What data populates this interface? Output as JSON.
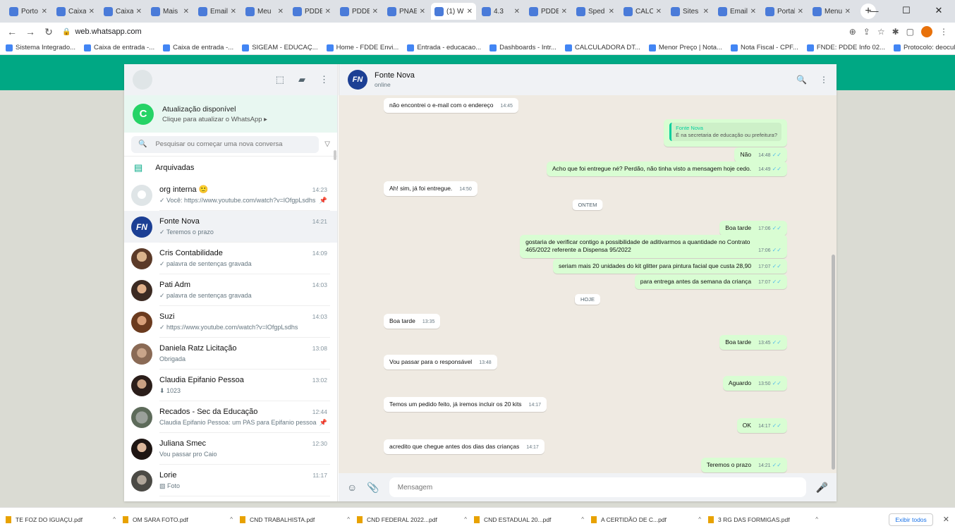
{
  "browser": {
    "tabs": [
      {
        "label": "Porto"
      },
      {
        "label": "Caixa"
      },
      {
        "label": "Caixa"
      },
      {
        "label": "Mais"
      },
      {
        "label": "Email"
      },
      {
        "label": "Meu"
      },
      {
        "label": "PDDE"
      },
      {
        "label": "PDDE"
      },
      {
        "label": "PNAE"
      },
      {
        "label": "(1) W",
        "active": true
      },
      {
        "label": "4.3"
      },
      {
        "label": "PDDE"
      },
      {
        "label": "Sped"
      },
      {
        "label": "CALC"
      },
      {
        "label": "Sites"
      },
      {
        "label": "Email"
      },
      {
        "label": "Portal"
      },
      {
        "label": "Menu"
      }
    ],
    "url": "web.whatsapp.com",
    "bookmarks": [
      "Sistema Integrado...",
      "Caixa de entrada -...",
      "Caixa de entrada -...",
      "SIGEAM - EDUCAÇ...",
      "Home - FDDE Envi...",
      "Entrada - educacao...",
      "Dashboards - Intr...",
      "CALCULADORA DT...",
      "Menor Preço | Nota...",
      "Nota Fiscal - CPF...",
      "FNDE: PDDE Info 02...",
      "Protocolo: deoculta..."
    ]
  },
  "sidebar": {
    "update_banner": {
      "title": "Atualização disponível",
      "subtitle": "Clique para atualizar o WhatsApp ▸"
    },
    "search": {
      "placeholder": "Pesquisar ou começar uma nova conversa"
    },
    "archived_label": "Arquivadas",
    "chats": [
      {
        "name": "org interna 🙂",
        "time": "14:23",
        "preview": "✓ Você: https://www.youtube.com/watch?v=lOfgpLsdhs",
        "flag": "📌",
        "avatar": "grp"
      },
      {
        "name": "Fonte Nova",
        "time": "14:21",
        "preview": "✓ Teremos o prazo",
        "avatar": "fn",
        "active": true
      },
      {
        "name": "Cris Contabilidade",
        "time": "14:09",
        "preview": "✓ palavra de sentenças gravada",
        "avatar": "ph1"
      },
      {
        "name": "Pati Adm",
        "time": "14:03",
        "preview": "✓ palavra de sentenças gravada",
        "avatar": "ph2"
      },
      {
        "name": "Suzi",
        "time": "14:03",
        "preview": "✓ https://www.youtube.com/watch?v=lOfgpLsdhs",
        "avatar": "ph3"
      },
      {
        "name": "Daniela Ratz Licitação",
        "time": "13:08",
        "preview": "Obrigada",
        "avatar": "ph4"
      },
      {
        "name": "Claudia Epifanio Pessoa",
        "time": "13:02",
        "preview": "⬇ 1023",
        "avatar": "ph5"
      },
      {
        "name": "Recados - Sec da Educação",
        "time": "12:44",
        "preview": "Claudia Epifanio Pessoa: um PAS para Epifanio pessoa no...",
        "flag": "📌",
        "avatar": "ph6"
      },
      {
        "name": "Juliana Smec",
        "time": "12:30",
        "preview": "Vou passar pro Caio",
        "avatar": "ph7"
      },
      {
        "name": "Lorie",
        "time": "11:17",
        "preview": "▧ Foto",
        "avatar": "ph8"
      }
    ]
  },
  "conversation": {
    "contact_name": "Fonte Nova",
    "contact_status": "online",
    "messages": [
      {
        "dir": "in",
        "text": "não encontrei o e-mail com o endereço",
        "time": "14:45"
      },
      {
        "dir": "out",
        "quote_name": "Fonte Nova",
        "quote_text": "É na secretaria de educação ou prefeitura?",
        "text": "",
        "time": ""
      },
      {
        "dir": "out",
        "text": "Não",
        "time": "14:48"
      },
      {
        "dir": "out",
        "text": "Acho que foi entregue né? Perdão, não tinha visto a mensagem hoje cedo.",
        "time": "14:49"
      },
      {
        "dir": "in",
        "text": "Ah! sim, já foi entregue.",
        "time": "14:50"
      },
      {
        "dir": "day",
        "text": "ONTEM"
      },
      {
        "dir": "out",
        "text": "Boa tarde",
        "time": "17:06"
      },
      {
        "dir": "out",
        "text": "gostaria de verificar contigo a possibilidade de aditivarmos a quantidade no Contrato 465/2022 referente a Dispensa 95/2022",
        "time": "17:06"
      },
      {
        "dir": "out",
        "text": "seriam mais 20 unidades do kit glitter para pintura facial que custa 28,90",
        "time": "17:07"
      },
      {
        "dir": "out",
        "text": "para entrega antes da semana da criança",
        "time": "17:07"
      },
      {
        "dir": "day",
        "text": "HOJE"
      },
      {
        "dir": "in",
        "text": "Boa tarde",
        "time": "13:35"
      },
      {
        "dir": "out",
        "text": "Boa tarde",
        "time": "13:45"
      },
      {
        "dir": "in",
        "text": "Vou passar para o responsável",
        "time": "13:48"
      },
      {
        "dir": "out",
        "text": "Aguardo",
        "time": "13:50"
      },
      {
        "dir": "in",
        "text": "Temos um pedido feito, já iremos incluir os 20 kits",
        "time": "14:17"
      },
      {
        "dir": "out",
        "text": "OK",
        "time": "14:17"
      },
      {
        "dir": "in",
        "text": "acredito que chegue antes dos dias das crianças",
        "time": "14:17"
      },
      {
        "dir": "out",
        "text": "Teremos o prazo",
        "time": "14:21"
      }
    ],
    "composer_placeholder": "Mensagem"
  },
  "downloads": {
    "items": [
      "TE FOZ DO IGUAÇU.pdf",
      "OM SARA FOTO.pdf",
      "CND TRABALHISTA.pdf",
      "CND FEDERAL 2022...pdf",
      "CND ESTADUAL 20...pdf",
      "A CERTIDÃO DE C...pdf",
      "3 RG DAS FORMIGAS.pdf"
    ],
    "show_all": "Exibir todos"
  }
}
